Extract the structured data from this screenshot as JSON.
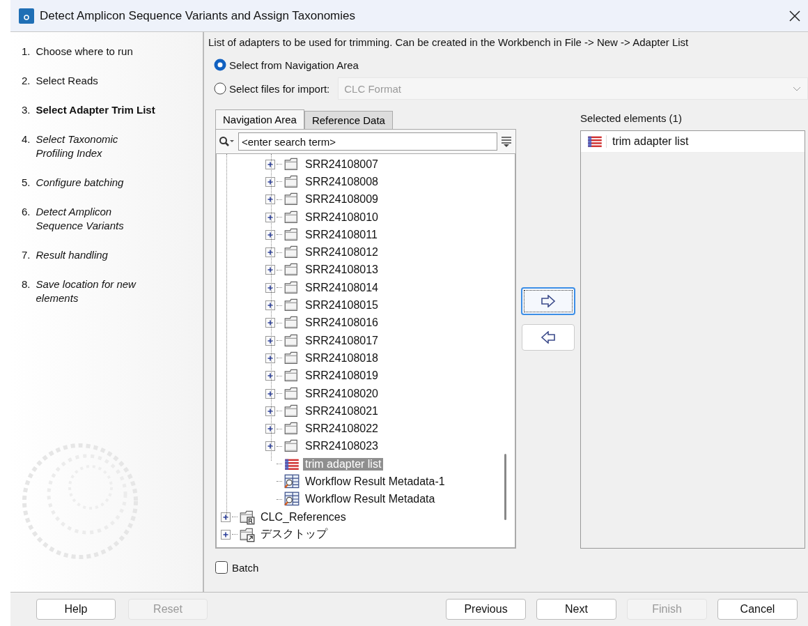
{
  "window": {
    "title": "Detect Amplicon Sequence Variants and Assign Taxonomies"
  },
  "steps": [
    {
      "number": "1.",
      "label": "Choose where to run",
      "kind": "done"
    },
    {
      "number": "2.",
      "label": "Select Reads",
      "kind": "done"
    },
    {
      "number": "3.",
      "label": "Select Adapter Trim List",
      "kind": "current"
    },
    {
      "number": "4.",
      "label": "Select Taxonomic Profiling Index",
      "kind": "upcoming"
    },
    {
      "number": "5.",
      "label": "Configure batching",
      "kind": "upcoming"
    },
    {
      "number": "6.",
      "label": "Detect Amplicon Sequence Variants",
      "kind": "upcoming"
    },
    {
      "number": "7.",
      "label": "Result handling",
      "kind": "upcoming"
    },
    {
      "number": "8.",
      "label": "Save location for new elements",
      "kind": "upcoming"
    }
  ],
  "description": "List of adapters to be used for trimming. Can be created in the Workbench in File -> New -> Adapter List",
  "source_options": [
    {
      "label": "Select from Navigation Area",
      "selected": true
    },
    {
      "label": "Select files for import:",
      "selected": false
    }
  ],
  "import_format": {
    "value": "CLC Format",
    "disabled": true
  },
  "tabs": [
    {
      "label": "Navigation Area",
      "selected": true
    },
    {
      "label": "Reference Data",
      "selected": false
    }
  ],
  "search": {
    "placeholder": "<enter search term>"
  },
  "tree": {
    "nested_items": [
      {
        "label": "SRR24108007",
        "kind": "folder",
        "selected": false
      },
      {
        "label": "SRR24108008",
        "kind": "folder",
        "selected": false
      },
      {
        "label": "SRR24108009",
        "kind": "folder",
        "selected": false
      },
      {
        "label": "SRR24108010",
        "kind": "folder",
        "selected": false
      },
      {
        "label": "SRR24108011",
        "kind": "folder",
        "selected": false
      },
      {
        "label": "SRR24108012",
        "kind": "folder",
        "selected": false
      },
      {
        "label": "SRR24108013",
        "kind": "folder",
        "selected": false
      },
      {
        "label": "SRR24108014",
        "kind": "folder",
        "selected": false
      },
      {
        "label": "SRR24108015",
        "kind": "folder",
        "selected": false
      },
      {
        "label": "SRR24108016",
        "kind": "folder",
        "selected": false
      },
      {
        "label": "SRR24108017",
        "kind": "folder",
        "selected": false
      },
      {
        "label": "SRR24108018",
        "kind": "folder",
        "selected": false
      },
      {
        "label": "SRR24108019",
        "kind": "folder",
        "selected": false
      },
      {
        "label": "SRR24108020",
        "kind": "folder",
        "selected": false
      },
      {
        "label": "SRR24108021",
        "kind": "folder",
        "selected": false
      },
      {
        "label": "SRR24108022",
        "kind": "folder",
        "selected": false
      },
      {
        "label": "SRR24108023",
        "kind": "folder",
        "selected": false
      },
      {
        "label": "trim adapter list",
        "kind": "adapter-list",
        "selected": true
      },
      {
        "label": "Workflow Result Metadata-1",
        "kind": "metadata",
        "selected": false
      },
      {
        "label": "Workflow Result Metadata",
        "kind": "metadata",
        "selected": false
      }
    ],
    "items": [
      {
        "label": "CLC_References",
        "kind": "reference-folder",
        "selected": false
      },
      {
        "label": "デスクトップ",
        "kind": "shortcut-folder",
        "selected": false
      }
    ]
  },
  "selected_elements": {
    "title": "Selected elements (1)",
    "items": [
      {
        "label": "trim adapter list",
        "kind": "adapter-list"
      }
    ]
  },
  "batch": {
    "label": "Batch",
    "checked": false
  },
  "buttons_left": [
    {
      "label": "Help",
      "disabled": false
    },
    {
      "label": "Reset",
      "disabled": true
    }
  ],
  "buttons_right": [
    {
      "label": "Previous",
      "disabled": false
    },
    {
      "label": "Next",
      "disabled": false
    },
    {
      "label": "Finish",
      "disabled": true
    },
    {
      "label": "Cancel",
      "disabled": false
    }
  ]
}
